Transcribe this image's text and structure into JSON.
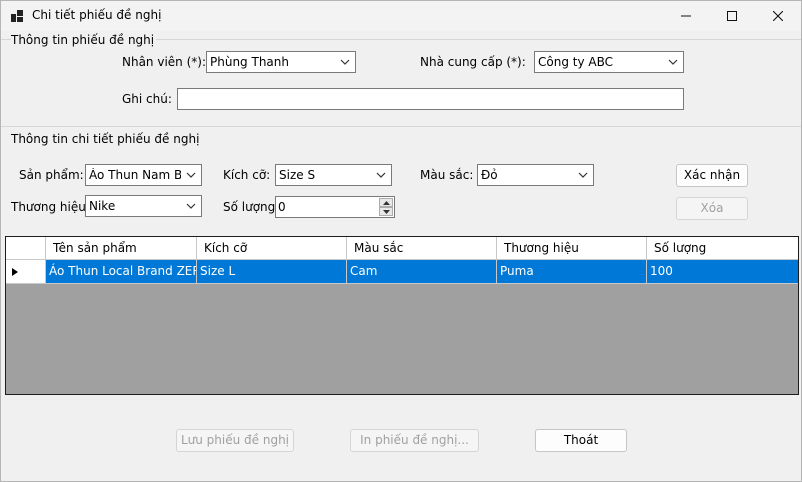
{
  "window": {
    "title": "Chi tiết phiếu đề nghị",
    "app_icon": "window-app-icon",
    "controls": [
      "minimize-icon",
      "maximize-icon",
      "close-icon"
    ]
  },
  "group_header": {
    "title": "Thông tin phiếu đề nghị",
    "employee_label": "Nhân viên (*):",
    "employee_value": "Phùng Thanh",
    "supplier_label": "Nhà cung cấp (*):",
    "supplier_value": "Công ty ABC",
    "note_label": "Ghi chú:",
    "note_value": ""
  },
  "group_detail": {
    "title": "Thông tin chi tiết phiếu đề nghị",
    "product_label": "Sản phẩm:",
    "product_value": "Áo Thun Nam Basic",
    "size_label": "Kích cỡ:",
    "size_value": "Size S",
    "color_label": "Màu sắc:",
    "color_value": "Đỏ",
    "brand_label": "Thương hiệu:",
    "brand_value": "Nike",
    "quantity_label": "Số lượng:",
    "quantity_value": "0",
    "confirm_button": "Xác nhận",
    "delete_button": "Xóa"
  },
  "grid": {
    "columns": [
      "Tên sản phẩm",
      "Kích cỡ",
      "Màu sắc",
      "Thương hiệu",
      "Số lượng"
    ],
    "rows": [
      [
        "Áo Thun Local Brand ZERO",
        "Size L",
        "Cam",
        "Puma",
        "100"
      ]
    ],
    "selection_color": "#0078d7",
    "empty_area_color": "#a0a0a0"
  },
  "footer": {
    "save_button": "Lưu phiếu đề nghị",
    "print_button": "In phiếu đề nghị...",
    "exit_button": "Thoát"
  }
}
